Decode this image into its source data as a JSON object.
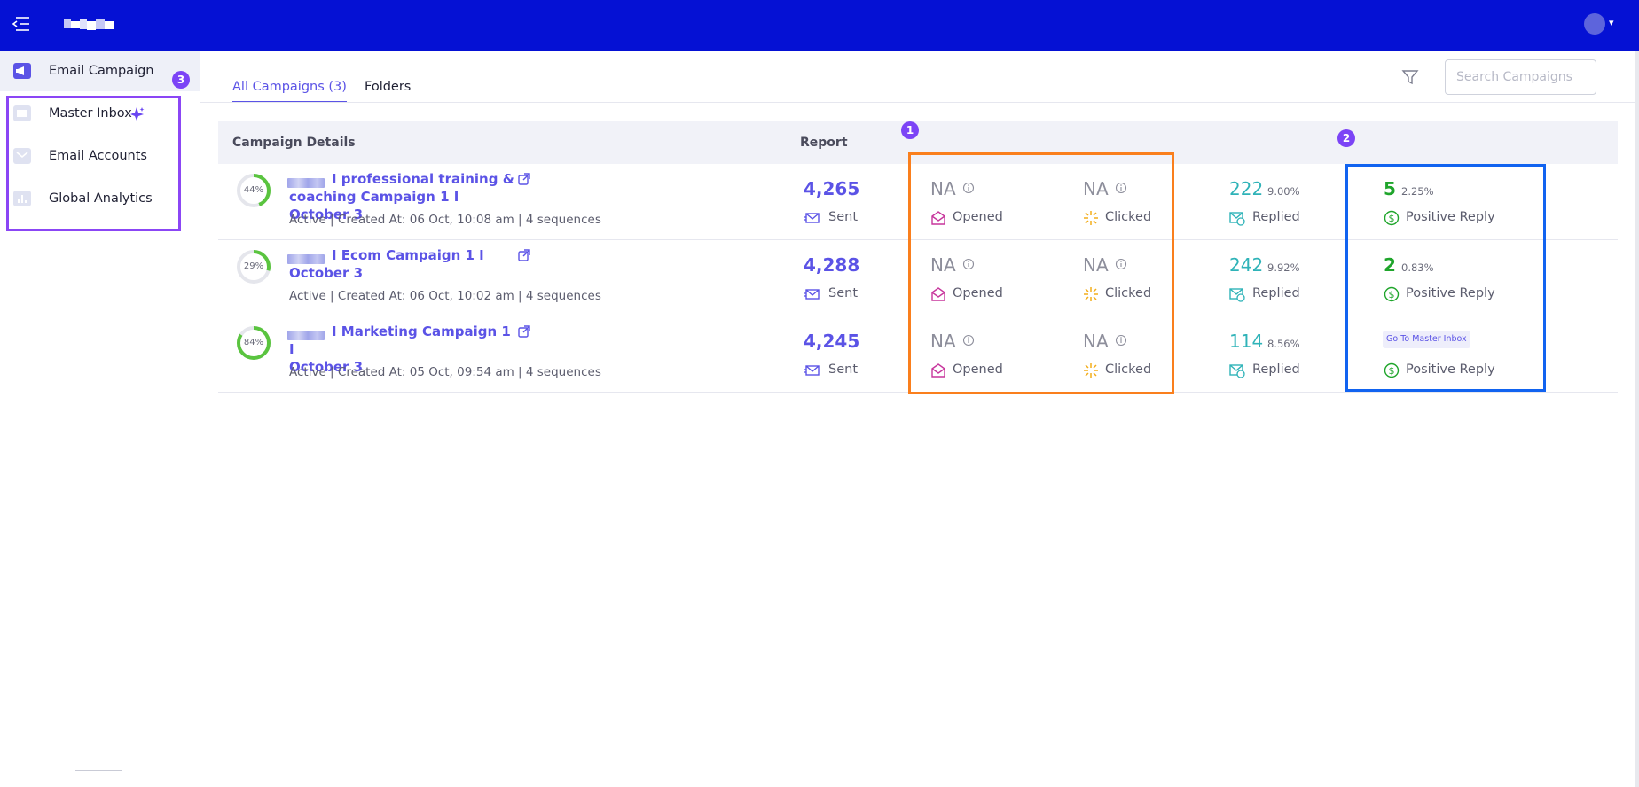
{
  "header": {
    "menu_icon": "hamburger-back-icon",
    "logo_icon": "blurred-logo",
    "avatar_icon": "user-avatar",
    "avatar_chevron": "▾",
    "brand_color": "#0511d4"
  },
  "sidebar": {
    "items": [
      {
        "label": "Email Campaign",
        "icon": "megaphone-icon",
        "active": true
      },
      {
        "label": "Master Inbox",
        "icon": "inbox-icon",
        "extra_icon": "sparkle-icon"
      },
      {
        "label": "Email Accounts",
        "icon": "mail-icon"
      },
      {
        "label": "Global Analytics",
        "icon": "bar-chart-icon"
      }
    ],
    "callout_badge": "3"
  },
  "main": {
    "tabs": [
      {
        "label": "All Campaigns (3)",
        "active": true
      },
      {
        "label": "Folders",
        "active": false
      }
    ],
    "filter_icon": "filter-icon",
    "search": {
      "placeholder": "Search Campaigns",
      "value": ""
    }
  },
  "table": {
    "headers": {
      "details": "Campaign Details",
      "report": "Report"
    },
    "callout_badges": [
      "1",
      "2"
    ],
    "rows": [
      {
        "progress_pct": 44,
        "progress_label": "44%",
        "name_line1": "I professional training &",
        "name_line2": "coaching Campaign 1 I October 3",
        "meta": "Active | Created At: 06 Oct, 10:08 am | 4 sequences",
        "sent": "4,265",
        "sent_label": "Sent",
        "opened": "NA",
        "opened_label": "Opened",
        "clicked": "NA",
        "clicked_label": "Clicked",
        "replied": "222",
        "replied_pct": "9.00%",
        "replied_label": "Replied",
        "positive": "5",
        "positive_pct": "2.25%",
        "positive_label": "Positive Reply"
      },
      {
        "progress_pct": 29,
        "progress_label": "29%",
        "name_line1": "I Ecom Campaign 1 I",
        "name_line2": "October 3",
        "meta": "Active | Created At: 06 Oct, 10:02 am | 4 sequences",
        "sent": "4,288",
        "sent_label": "Sent",
        "opened": "NA",
        "opened_label": "Opened",
        "clicked": "NA",
        "clicked_label": "Clicked",
        "replied": "242",
        "replied_pct": "9.92%",
        "replied_label": "Replied",
        "positive": "2",
        "positive_pct": "0.83%",
        "positive_label": "Positive Reply"
      },
      {
        "progress_pct": 84,
        "progress_label": "84%",
        "name_line1": "I Marketing Campaign 1 I",
        "name_line2": "October 3",
        "meta": "Active | Created At: 05 Oct, 09:54 am | 4 sequences",
        "sent": "4,245",
        "sent_label": "Sent",
        "opened": "NA",
        "opened_label": "Opened",
        "clicked": "NA",
        "clicked_label": "Clicked",
        "replied": "114",
        "replied_pct": "8.56%",
        "replied_label": "Replied",
        "goto_label": "Go To Master Inbox",
        "positive_label": "Positive Reply"
      }
    ]
  },
  "colors": {
    "accent": "#5b53e6",
    "replied": "#2fb3b8",
    "positive": "#1fa52b",
    "na": "#8d8e9b",
    "opened_icon": "#c7359c",
    "clicked_icon": "#f3ad1a",
    "progress_green": "#5ac43f",
    "callout_orange": "#fa7f1d",
    "callout_blue": "#1163f0",
    "callout_purple": "#8b46f5"
  }
}
